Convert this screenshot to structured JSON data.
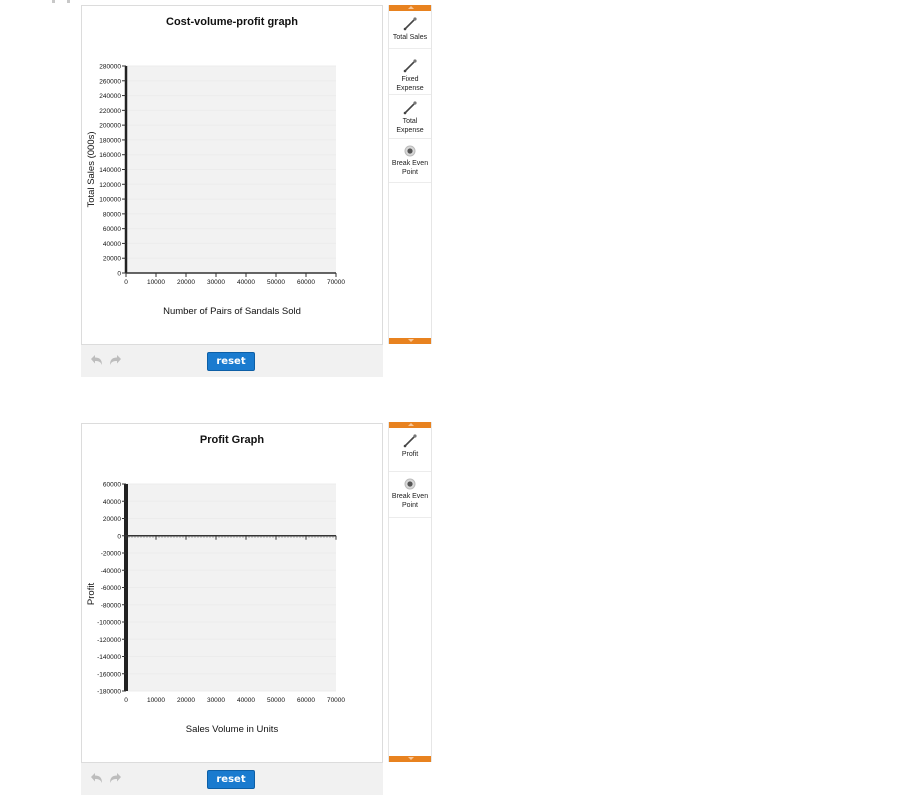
{
  "colors": {
    "accent_orange": "#e8821f",
    "reset_blue": "#1a7bcf",
    "plot_bg": "#f2f2f2",
    "axis": "#333333"
  },
  "charts": [
    {
      "title": "Cost-volume-profit graph",
      "toolbar": {
        "undo_icon": "undo-icon",
        "redo_icon": "redo-icon",
        "reset_label": "reset"
      },
      "tools": [
        {
          "label": "Total Sales",
          "icon": "line-tool-icon"
        },
        {
          "label": "Fixed Expense",
          "icon": "line-tool-icon"
        },
        {
          "label": "Total Expense",
          "icon": "line-tool-icon"
        },
        {
          "label": "Break Even Point",
          "icon": "point-tool-icon"
        }
      ]
    },
    {
      "title": "Profit Graph",
      "toolbar": {
        "undo_icon": "undo-icon",
        "redo_icon": "redo-icon",
        "reset_label": "reset"
      },
      "tools": [
        {
          "label": "Profit",
          "icon": "line-tool-icon"
        },
        {
          "label": "Break Even Point",
          "icon": "point-tool-icon"
        }
      ]
    }
  ],
  "chart_data": [
    {
      "type": "line",
      "title": "Cost-volume-profit graph",
      "xlabel": "Number of Pairs of Sandals Sold",
      "ylabel": "Total Sales (000s)",
      "xlim": [
        0,
        70000
      ],
      "ylim": [
        0,
        280000
      ],
      "x_ticks": [
        0,
        10000,
        20000,
        30000,
        40000,
        50000,
        60000,
        70000
      ],
      "y_ticks": [
        0,
        20000,
        40000,
        60000,
        80000,
        100000,
        120000,
        140000,
        160000,
        180000,
        200000,
        220000,
        240000,
        260000,
        280000
      ],
      "grid": true,
      "series": []
    },
    {
      "type": "line",
      "title": "Profit Graph",
      "xlabel": "Sales Volume in Units",
      "ylabel": "Profit",
      "xlim": [
        0,
        70000
      ],
      "ylim": [
        -180000,
        60000
      ],
      "x_ticks": [
        0,
        10000,
        20000,
        30000,
        40000,
        50000,
        60000,
        70000
      ],
      "y_ticks": [
        60000,
        40000,
        20000,
        0,
        -20000,
        -40000,
        -60000,
        -80000,
        -100000,
        -120000,
        -140000,
        -160000,
        -180000
      ],
      "grid": true,
      "series": []
    }
  ]
}
